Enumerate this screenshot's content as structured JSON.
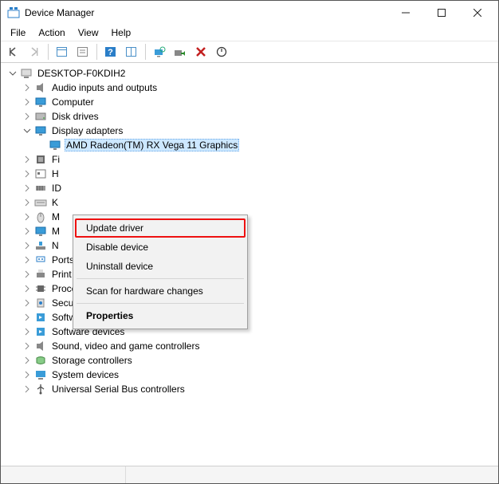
{
  "window": {
    "title": "Device Manager"
  },
  "menubar": {
    "file": "File",
    "action": "Action",
    "view": "View",
    "help": "Help"
  },
  "toolbar": {
    "back": "back-icon",
    "forward": "forward-icon",
    "show_hidden": "show-hidden-icon",
    "properties": "properties-icon",
    "help": "help-icon",
    "view_mode": "view-mode-icon",
    "scan": "scan-icon",
    "update": "update-driver-icon",
    "uninstall": "uninstall-icon",
    "disable": "disable-icon"
  },
  "tree": {
    "root": {
      "label": "DESKTOP-F0KDIH2",
      "expanded": true
    },
    "nodes": [
      {
        "label": "Audio inputs and outputs",
        "icon": "speaker-icon",
        "expanded": false
      },
      {
        "label": "Computer",
        "icon": "monitor-icon",
        "expanded": false
      },
      {
        "label": "Disk drives",
        "icon": "disk-icon",
        "expanded": false
      },
      {
        "label": "Display adapters",
        "icon": "monitor-icon",
        "expanded": true,
        "children": [
          {
            "label": "AMD Radeon(TM) RX Vega 11 Graphics",
            "icon": "monitor-icon",
            "selected": true
          }
        ]
      },
      {
        "label": "Firmware",
        "short": "Fi",
        "icon": "chip-icon",
        "expanded": false
      },
      {
        "label": "Human Interface Devices",
        "short": "H",
        "icon": "hid-icon",
        "expanded": false
      },
      {
        "label": "IDE ATA/ATAPI controllers",
        "short": "ID",
        "icon": "ide-icon",
        "expanded": false
      },
      {
        "label": "Keyboards",
        "short": "K",
        "icon": "keyboard-icon",
        "expanded": false
      },
      {
        "label": "Mice and other pointing devices",
        "short": "M",
        "icon": "mouse-icon",
        "expanded": false
      },
      {
        "label": "Monitors",
        "short": "M",
        "icon": "monitor-icon",
        "expanded": false
      },
      {
        "label": "Network adapters",
        "short": "N",
        "icon": "network-icon",
        "expanded": false
      },
      {
        "label": "Ports (COM & LPT)",
        "icon": "port-icon",
        "expanded": false
      },
      {
        "label": "Print queues",
        "icon": "printer-icon",
        "expanded": false
      },
      {
        "label": "Processors",
        "icon": "cpu-icon",
        "expanded": false
      },
      {
        "label": "Security devices",
        "icon": "security-icon",
        "expanded": false
      },
      {
        "label": "Software components",
        "icon": "software-icon",
        "expanded": false
      },
      {
        "label": "Software devices",
        "icon": "software-icon",
        "expanded": false
      },
      {
        "label": "Sound, video and game controllers",
        "icon": "speaker-icon",
        "expanded": false
      },
      {
        "label": "Storage controllers",
        "icon": "storage-icon",
        "expanded": false
      },
      {
        "label": "System devices",
        "icon": "system-icon",
        "expanded": false
      },
      {
        "label": "Universal Serial Bus controllers",
        "icon": "usb-icon",
        "expanded": false
      }
    ]
  },
  "context_menu": {
    "update": "Update driver",
    "disable": "Disable device",
    "uninstall": "Uninstall device",
    "scan": "Scan for hardware changes",
    "properties": "Properties"
  }
}
